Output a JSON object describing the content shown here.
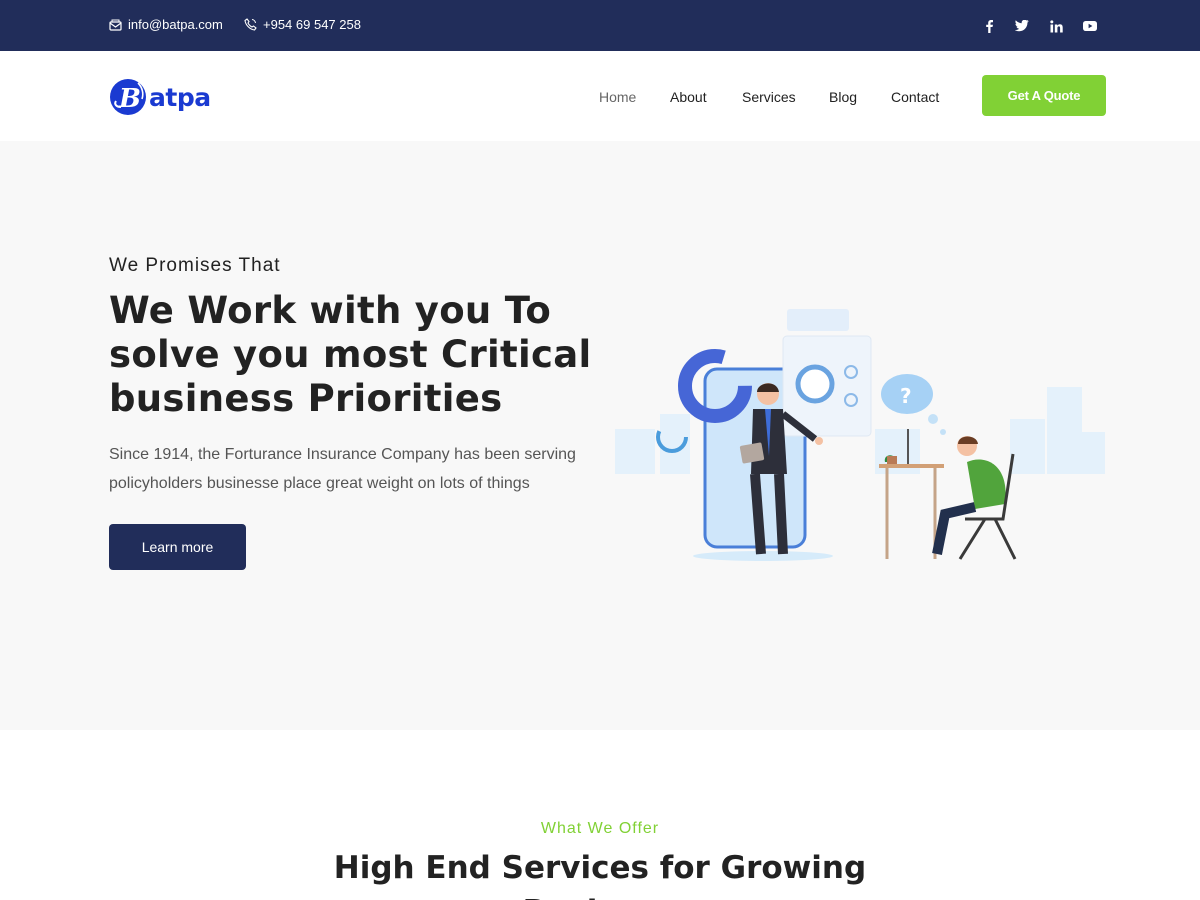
{
  "topbar": {
    "email": "info@batpa.com",
    "phone": "+954 69 547 258",
    "social_icons": [
      "facebook-icon",
      "twitter-icon",
      "linkedin-icon",
      "youtube-icon"
    ]
  },
  "header": {
    "logo_text": "atpa",
    "nav": [
      "Home",
      "About",
      "Services",
      "Blog",
      "Contact"
    ],
    "active_nav": "Home",
    "cta_label": "Get A Quote"
  },
  "hero": {
    "kicker": "We Promises That",
    "title_lines": [
      "We Work with you To",
      "solve you most Critical",
      "business Priorities"
    ],
    "description": "Since 1914, the Forturance Insurance Company has been serving policyholders businesse place great weight on lots of things",
    "button_label": "Learn more"
  },
  "offer": {
    "kicker": "What We Offer",
    "title": "High End Services for Growing Business"
  },
  "colors": {
    "navy": "#212d5a",
    "green": "#81d135",
    "brand_blue": "#1a3ad1",
    "hero_bg": "#f8f8f8"
  }
}
